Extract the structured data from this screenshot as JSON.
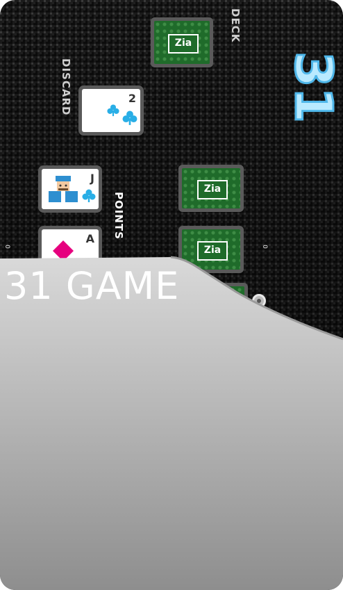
{
  "app": {
    "title": "31 GAME",
    "logo_text": "31"
  },
  "board": {
    "deck_label": "DECK",
    "discard_label": "DISCARD",
    "points_label": "POINTS",
    "left_score": "0",
    "right_score": "0"
  },
  "discard_card": {
    "rank": "2",
    "suit": "clubs"
  },
  "player_cards": [
    {
      "rank": "J",
      "suit": "clubs",
      "face": "jack"
    },
    {
      "rank": "A",
      "suit": "diamonds"
    }
  ],
  "card_back_logo": "Zia",
  "colors": {
    "logo_fill": "#b9eaff",
    "logo_stroke": "#4fb7ea",
    "card_back": "#1f6b2a",
    "club": "#29aee6",
    "diamond": "#e6007e"
  }
}
